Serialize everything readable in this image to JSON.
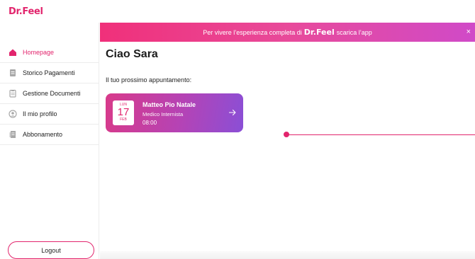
{
  "app": {
    "brand": "Dr.Feel",
    "accent_color": "#e2256d"
  },
  "sidebar": {
    "items": [
      {
        "label": "Homepage",
        "icon": "home-icon",
        "active": true
      },
      {
        "label": "Storico Pagamenti",
        "icon": "document-icon",
        "active": false
      },
      {
        "label": "Gestione Documenti",
        "icon": "clipboard-icon",
        "active": false
      },
      {
        "label": "Il mio profilo",
        "icon": "user-icon",
        "active": false
      },
      {
        "label": "Abbonamento",
        "icon": "receipt-icon",
        "active": false
      }
    ],
    "logout_label": "Logout"
  },
  "banner": {
    "text_before": "Per vivere l’esperienza completa di",
    "brand": "Dr.Feel",
    "text_after": "scarica l’app",
    "close": "×"
  },
  "main": {
    "greeting": "Ciao Sara",
    "subtitle": "Il tuo prossimo appuntamento:",
    "appointment": {
      "weekday": "LUN",
      "day": "17",
      "month": "FEB",
      "doctor": "Matteo Pio Natale",
      "specialty": "Medico Internista",
      "time": "08:00"
    }
  }
}
